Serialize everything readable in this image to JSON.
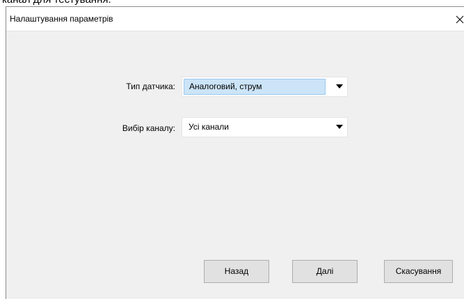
{
  "background": {
    "top_fragment": "канал для тестування."
  },
  "dialog": {
    "title": "Налаштування параметрів",
    "close_glyph": "✕",
    "fields": {
      "sensor_type": {
        "label": "Тип датчика:",
        "value": "Аналоговий, струм"
      },
      "channel": {
        "label": "Вибір каналу:",
        "value": "Усі канали"
      }
    },
    "buttons": {
      "back": "Назад",
      "next": "Далі",
      "cancel": "Скасування"
    }
  },
  "colors": {
    "dialog_background": "#f0f0f0",
    "titlebar_background": "#ffffff",
    "selection_highlight": "#cce4f7",
    "button_face": "#e1e1e1",
    "button_border": "#adadad"
  },
  "icons": {
    "close": "close-icon",
    "dropdown": "chevron-down-icon"
  }
}
